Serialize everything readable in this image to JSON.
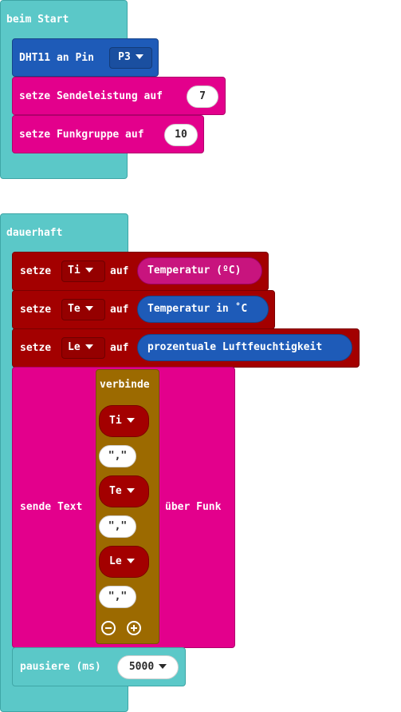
{
  "start_block": {
    "title": "beim Start",
    "dht_block": {
      "label": "DHT11 an Pin",
      "pin": "P3"
    },
    "power_block": {
      "label": "setze Sendeleistung auf",
      "value": "7"
    },
    "group_block": {
      "label": "setze Funkgruppe auf",
      "value": "10"
    }
  },
  "forever_block": {
    "title": "dauerhaft",
    "set_ti": {
      "setze": "setze",
      "var": "Ti",
      "auf": "auf",
      "value": "Temperatur (ºC)"
    },
    "set_te": {
      "setze": "setze",
      "var": "Te",
      "auf": "auf",
      "value": "Temperatur in ˚C"
    },
    "set_le": {
      "setze": "setze",
      "var": "Le",
      "auf": "auf",
      "value": "prozentuale Luftfeuchtigkeit"
    },
    "send_block": {
      "label": "sende Text",
      "suffix": "über Funk",
      "join": {
        "label": "verbinde",
        "items": [
          "Ti",
          "\",\"",
          "Te",
          "\",\"",
          "Le",
          "\",\""
        ]
      }
    },
    "pause_block": {
      "label": "pausiere (ms)",
      "value": "5000"
    }
  },
  "colors": {
    "basic": "#5bc8c8",
    "sensor": "#1e5bb8",
    "radio": "#e3008c",
    "variables": "#a30000",
    "text": "#9c6a00"
  }
}
